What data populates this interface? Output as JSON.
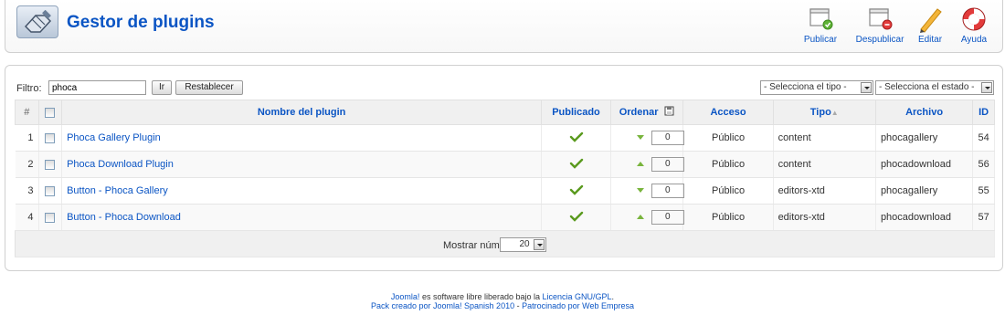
{
  "header": {
    "title": "Gestor de plugins",
    "icon": "plugin-icon",
    "toolbar": [
      {
        "label": "Publicar",
        "icon": "publish-icon"
      },
      {
        "label": "Despublicar",
        "icon": "unpublish-icon"
      },
      {
        "label": "Editar",
        "icon": "edit-icon"
      },
      {
        "label": "Ayuda",
        "icon": "help-icon"
      }
    ]
  },
  "filter": {
    "label": "Filtro:",
    "value": "phoca",
    "go_label": "Ir",
    "reset_label": "Restablecer",
    "type_select": "- Selecciona el tipo -",
    "state_select": "- Selecciona el estado -"
  },
  "table": {
    "headers": {
      "num": "#",
      "name": "Nombre del plugin",
      "published": "Publicado",
      "order": "Ordenar",
      "access": "Acceso",
      "type": "Tipo",
      "file": "Archivo",
      "id": "ID"
    },
    "rows": [
      {
        "num": "1",
        "name": "Phoca Gallery Plugin",
        "published": true,
        "order_arrow": "down",
        "order": "0",
        "access": "Público",
        "type": "content",
        "file": "phocagallery",
        "id": "54"
      },
      {
        "num": "2",
        "name": "Phoca Download Plugin",
        "published": true,
        "order_arrow": "up",
        "order": "0",
        "access": "Público",
        "type": "content",
        "file": "phocadownload",
        "id": "56"
      },
      {
        "num": "3",
        "name": "Button - Phoca Gallery",
        "published": true,
        "order_arrow": "down",
        "order": "0",
        "access": "Público",
        "type": "editors-xtd",
        "file": "phocagallery",
        "id": "55"
      },
      {
        "num": "4",
        "name": "Button - Phoca Download",
        "published": true,
        "order_arrow": "up",
        "order": "0",
        "access": "Público",
        "type": "editors-xtd",
        "file": "phocadownload",
        "id": "57"
      }
    ],
    "limit_label": "Mostrar núm.",
    "limit_value": "20"
  },
  "footer": {
    "line1_link1": "Joomla!",
    "line1_text": " es software libre liberado bajo la ",
    "line1_link2": "Licencia GNU/GPL",
    "line1_end": ".",
    "line2_link1": "Pack creado por Joomla! Spanish 2010",
    "line2_sep": " - ",
    "line2_link2": "Patrocinado por Web Empresa"
  },
  "colors": {
    "link": "#0b55c4",
    "access": "#008000",
    "check": "#5a9a1e",
    "order_arrow": "#78b43c"
  }
}
